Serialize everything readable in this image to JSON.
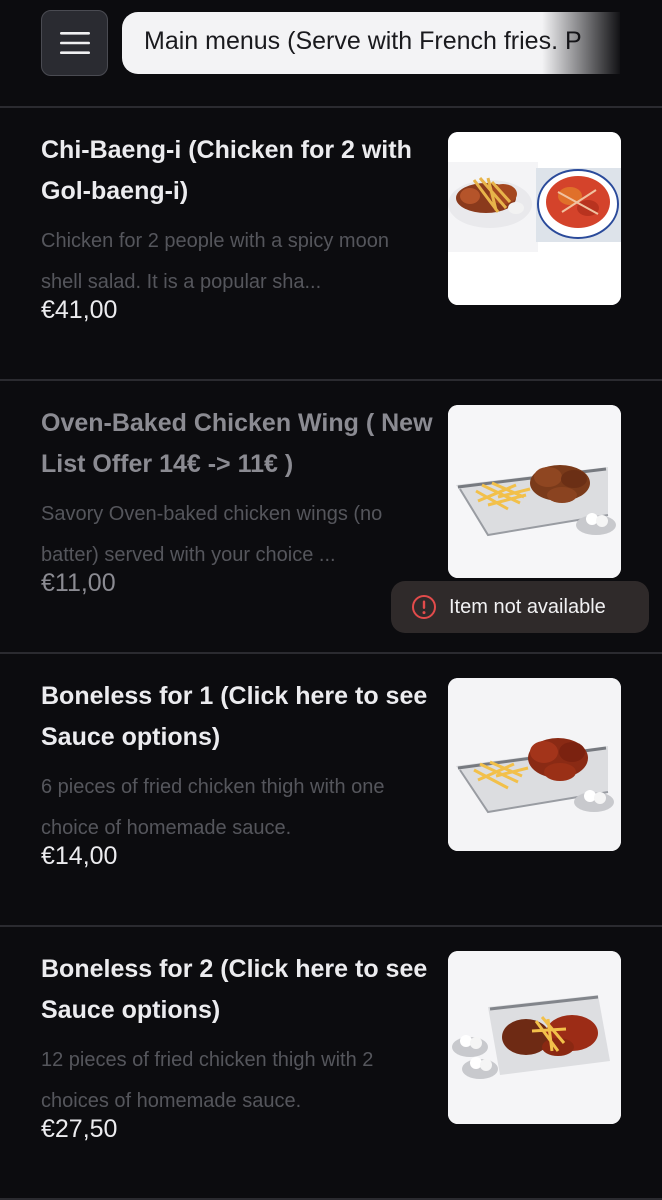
{
  "header": {
    "menu_icon": "hamburger-menu-icon",
    "category_label": "Main menus (Serve with French fries. P"
  },
  "items": [
    {
      "title": "Chi-Baeng-i (Chicken for 2 with Gol-baeng-i)",
      "description": "Chicken for 2 people with a spicy moon shell salad. It is a popular sha...",
      "price": "€41,00",
      "available": true,
      "image": "chicken-with-spicy-salad-photo"
    },
    {
      "title": "Oven-Baked Chicken Wing ( New List Offer 14€ -> 11€ )",
      "description": "Savory Oven-baked chicken wings (no batter) served with your choice ...",
      "price": "€11,00",
      "available": false,
      "image": "chicken-wings-fries-photo"
    },
    {
      "title": "Boneless for 1 (Click here to see Sauce options)",
      "description": "6 pieces of fried chicken thigh with one choice of homemade sauce.",
      "price": "€14,00",
      "available": true,
      "image": "boneless-chicken-fries-photo"
    },
    {
      "title": "Boneless for 2 (Click here to see Sauce options)",
      "description": "12 pieces of fried chicken thigh with 2 choices of homemade sauce.",
      "price": "€27,50",
      "available": true,
      "image": "boneless-chicken-for-two-photo"
    }
  ],
  "toast": {
    "icon": "error-circle-icon",
    "message": "Item not available"
  },
  "colors": {
    "background": "#0c0c0f",
    "divider": "#2b2b30",
    "pill": "#f3f3f5",
    "toast_bg": "#2f2a2a",
    "error": "#e24b4b"
  }
}
